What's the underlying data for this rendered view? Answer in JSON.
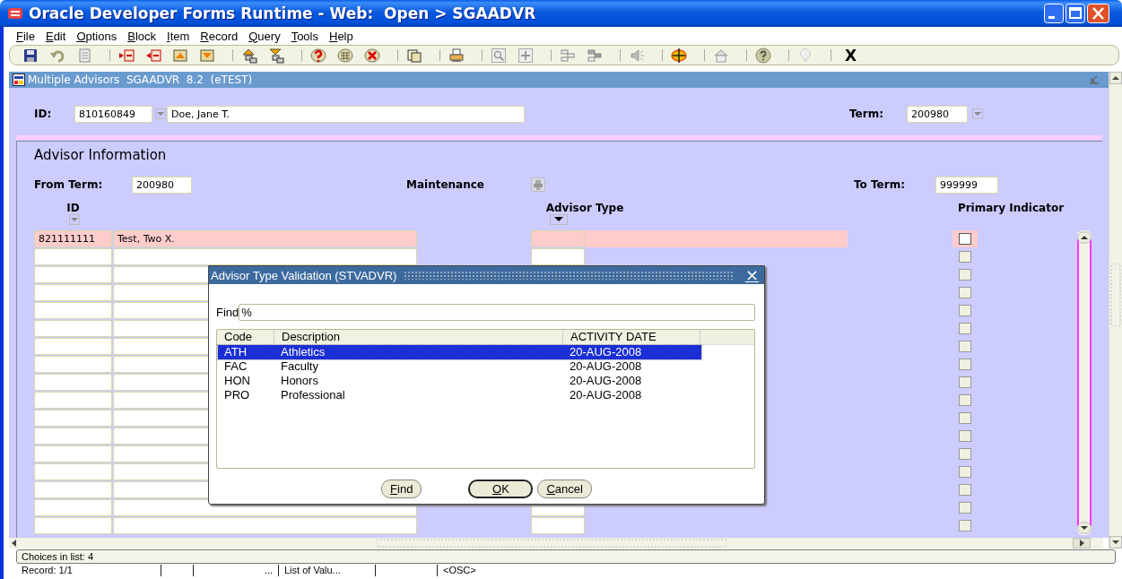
{
  "window": {
    "title": "Oracle Developer Forms Runtime - Web:  Open > SGAADVR"
  },
  "menu": [
    "File",
    "Edit",
    "Options",
    "Block",
    "Item",
    "Record",
    "Query",
    "Tools",
    "Help"
  ],
  "toolbar": {
    "exit": "X"
  },
  "form": {
    "title": "Multiple Advisors  SGAADVR  8.2  (eTEST)",
    "key_block": {
      "id_label": "ID:",
      "id": "810160849",
      "name": "Doe, Jane T.",
      "term_label": "Term:",
      "term": "200980"
    },
    "section_title": "Advisor Information",
    "from_term_label": "From Term:",
    "from_term": "200980",
    "maintenance_label": "Maintenance",
    "to_term_label": "To Term:",
    "to_term": "999999",
    "columns": [
      "ID",
      "Advisor Type",
      "Primary Indicator"
    ],
    "records": [
      {
        "id": "821111111",
        "name": "Test, Two X.",
        "current": true,
        "primary": false
      },
      {
        "current": false,
        "primary": false
      },
      {
        "current": false,
        "primary": false
      },
      {
        "current": false,
        "primary": false
      },
      {
        "current": false,
        "primary": false
      },
      {
        "current": false,
        "primary": false
      },
      {
        "current": false,
        "primary": false
      },
      {
        "current": false,
        "primary": false
      },
      {
        "current": false,
        "primary": false
      },
      {
        "current": false,
        "primary": false
      },
      {
        "current": false,
        "primary": false
      },
      {
        "current": false,
        "primary": false
      },
      {
        "current": false,
        "primary": false
      },
      {
        "current": false,
        "primary": false
      },
      {
        "current": false,
        "primary": false
      },
      {
        "current": false,
        "primary": false
      },
      {
        "current": false,
        "primary": false
      }
    ]
  },
  "dialog": {
    "title": "Advisor Type Validation (STVADVR)",
    "close": "×",
    "find_label": "Find",
    "find_value": "%",
    "columns": [
      "Code",
      "Description",
      "ACTIVITY DATE"
    ],
    "rows": [
      {
        "code": "ATH",
        "description": "Athletics",
        "date": "20-AUG-2008",
        "selected": true
      },
      {
        "code": "FAC",
        "description": "Faculty",
        "date": "20-AUG-2008",
        "selected": false
      },
      {
        "code": "HON",
        "description": "Honors",
        "date": "20-AUG-2008",
        "selected": false
      },
      {
        "code": "PRO",
        "description": "Professional",
        "date": "20-AUG-2008",
        "selected": false
      }
    ],
    "buttons": [
      {
        "label": "Find",
        "default": false
      },
      {
        "label": "OK",
        "default": true
      },
      {
        "label": "Cancel",
        "default": false
      }
    ]
  },
  "status": {
    "message": "Choices in list: 4",
    "record": "Record: 1/1",
    "ellipsis": "...",
    "lov": "List of Valu...",
    "osc": "<OSC>"
  }
}
